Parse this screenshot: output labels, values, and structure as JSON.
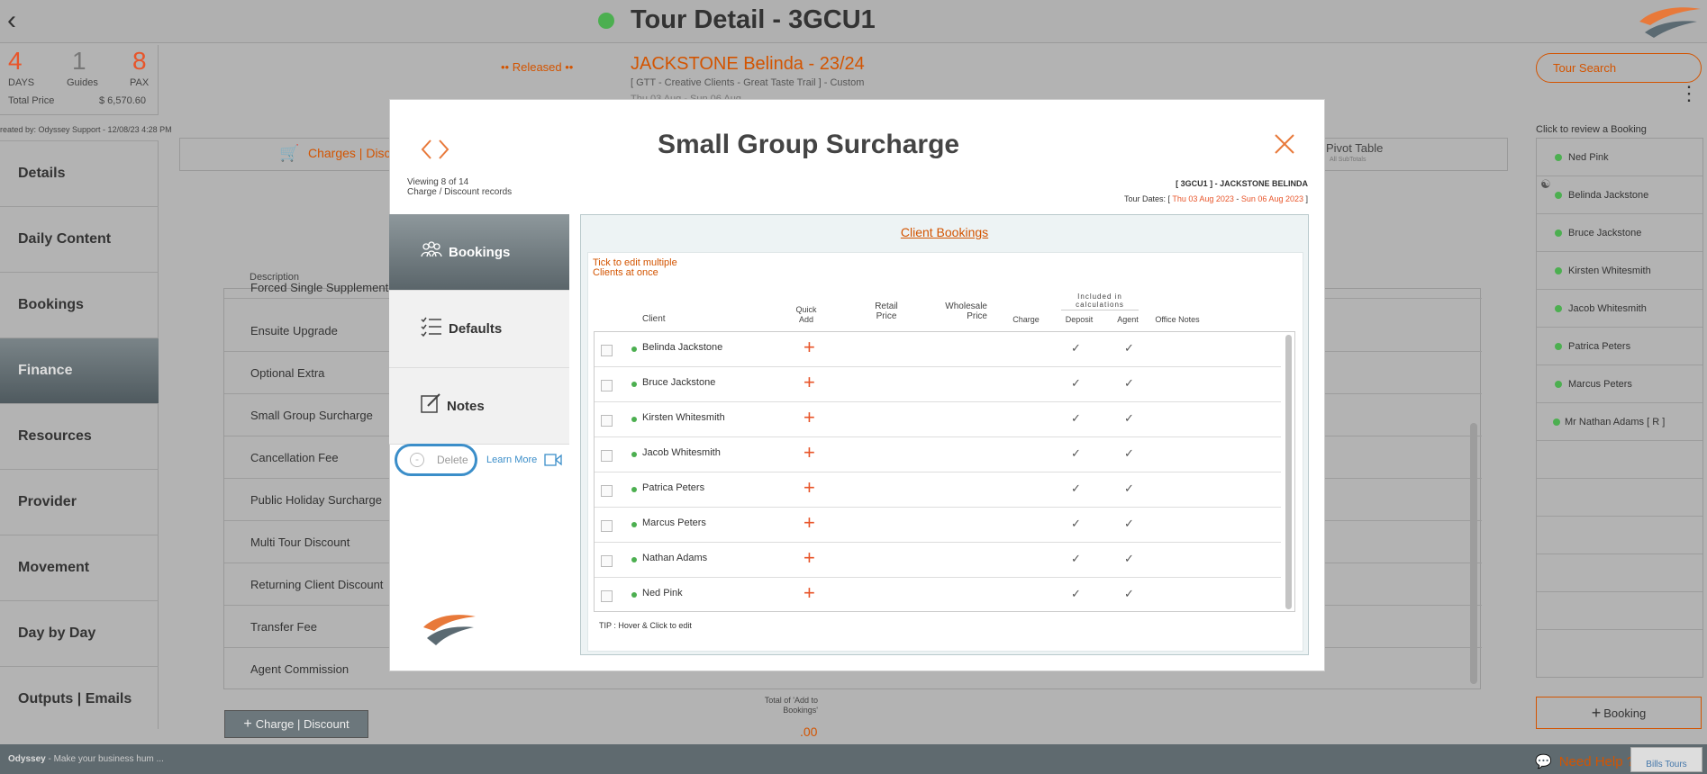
{
  "header": {
    "title": "Tour Detail - 3GCU1"
  },
  "stats": {
    "days_num": "4",
    "days_lbl": "DAYS",
    "guides_num": "1",
    "guides_lbl": "Guides",
    "pax_num": "8",
    "pax_lbl": "PAX",
    "total_lbl": "Total Price",
    "total_val": "$ 6,570.60"
  },
  "created_by": "reated by: Odyssey Support - 12/08/23 4:28 PM",
  "nav": [
    "Details",
    "Daily Content",
    "Bookings",
    "Finance",
    "Resources",
    "Provider",
    "Movement",
    "Day by Day",
    "Outputs | Emails"
  ],
  "tour": {
    "released": "•• Released ••",
    "client": "JACKSTONE Belinda - 23/24",
    "subtitle": "[ GTT - Creative Clients - Great Taste Trail ] - Custom",
    "dates": "Thu 03 Aug - Sun 06 Aug"
  },
  "tabs": {
    "charges": "Charges | Discou",
    "pivot": "Pivot Table",
    "pivot_sub": "All SubTotals"
  },
  "list": {
    "description_header": "Description",
    "items": [
      "Forced Single Supplement",
      "Ensuite Upgrade",
      "Optional Extra",
      "Small Group Surcharge",
      "Cancellation Fee",
      "Public Holiday Surcharge",
      "Multi Tour Discount",
      "Returning Client Discount",
      "Transfer Fee",
      "Agent Commission"
    ]
  },
  "add_charge": "Charge | Discount",
  "totals": {
    "label": "Total of 'Add to Bookings'",
    "value": ".00"
  },
  "right": {
    "tour_search": "Tour Search",
    "review": "Click to review a Booking",
    "bookings": [
      "Ned Pink",
      "Belinda Jackstone",
      "Bruce Jackstone",
      "Kirsten Whitesmith",
      "Jacob Whitesmith",
      "Patrica Peters",
      "Marcus Peters",
      "Mr Nathan Adams  [ R ]"
    ],
    "booking_btn": "Booking"
  },
  "footer": {
    "brand": "Odyssey",
    "tagline": " - Make your business hum ...",
    "help": "Need Help ?",
    "bills": "Bills Tours"
  },
  "modal": {
    "title": "Small Group Surcharge",
    "viewing": "Viewing 8 of 14",
    "records": "Charge / Discount records",
    "tour_code": "[ 3GCU1 ] - JACKSTONE BELINDA",
    "dates_label": "Tour Dates: [ ",
    "date_start": "Thu 03 Aug 2023",
    "date_sep": " - ",
    "date_end": "Sun 06 Aug 2023",
    "dates_close": " ]",
    "tabs": [
      "Bookings",
      "Defaults",
      "Notes"
    ],
    "delete": "Delete",
    "learn_more": "Learn More",
    "content_title": "Client Bookings",
    "tick_note_1": "Tick to edit multiple",
    "tick_note_2": "Clients at once",
    "headers": {
      "client": "Client",
      "quick_add_1": "Quick",
      "quick_add_2": "Add",
      "retail_1": "Retail",
      "retail_2": "Price",
      "wholesale_1": "Wholesale",
      "wholesale_2": "Price",
      "charge": "Charge",
      "included_1": "Included in",
      "included_2": "calculations",
      "deposit": "Deposit",
      "agent": "Agent",
      "office_notes": "Office Notes"
    },
    "clients": [
      "Belinda Jackstone",
      "Bruce Jackstone",
      "Kirsten Whitesmith",
      "Jacob Whitesmith",
      "Patrica Peters",
      "Marcus Peters",
      "Nathan Adams",
      "Ned Pink"
    ],
    "tip": "TIP : Hover & Click to edit"
  }
}
